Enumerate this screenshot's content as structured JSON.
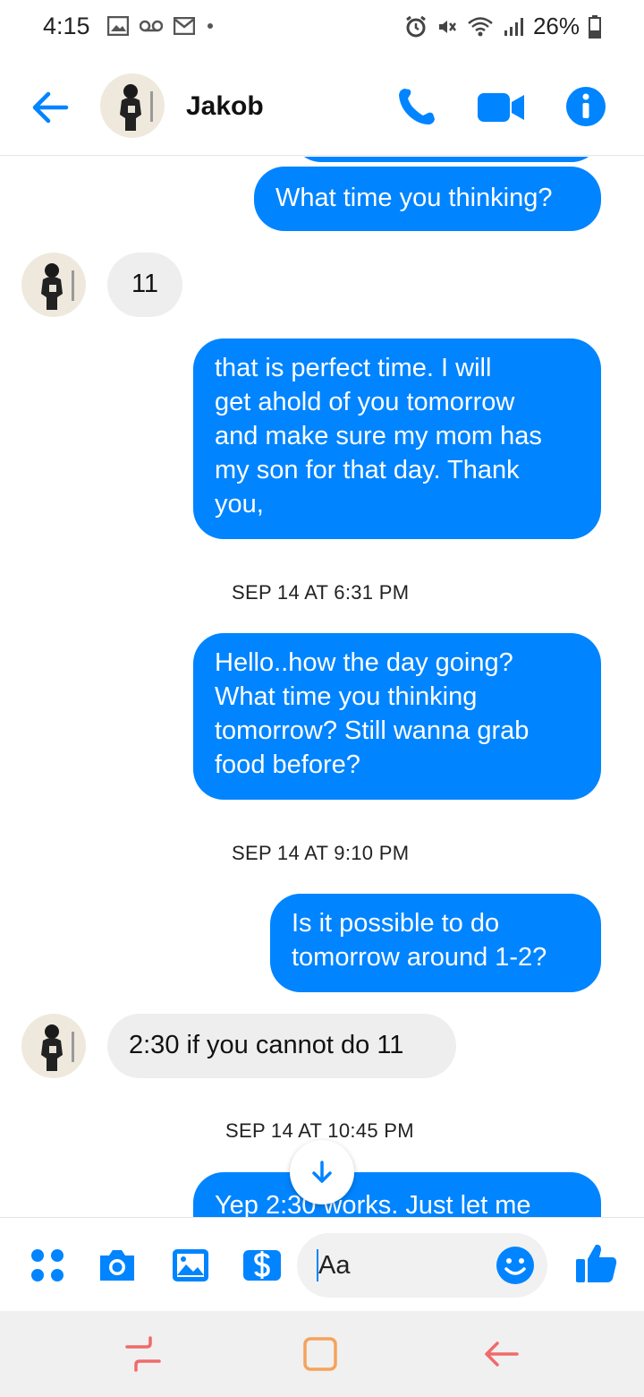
{
  "status_bar": {
    "time": "4:15",
    "battery": "26%"
  },
  "header": {
    "contact_name": "Jakob"
  },
  "messages": [
    {
      "dir": "out",
      "text": "What time you thinking?"
    },
    {
      "dir": "in",
      "text": "11"
    },
    {
      "dir": "out",
      "lines": [
        "that is perfect time.  I will",
        "get ahold of you tomorrow",
        "and make sure my mom has",
        "my son for that day. Thank",
        "you,"
      ]
    },
    {
      "dir": "stamp",
      "text": "SEP 14 AT 6:31 PM"
    },
    {
      "dir": "out",
      "lines": [
        "Hello..how the day going?",
        "What time  you thinking",
        "tomorrow? Still wanna grab",
        "food before?"
      ]
    },
    {
      "dir": "stamp",
      "text": "SEP 14 AT 9:10 PM"
    },
    {
      "dir": "out",
      "lines": [
        "Is it possible  to do",
        "tomorrow  around 1-2?"
      ]
    },
    {
      "dir": "in",
      "text": "2:30 if you cannot do 11"
    },
    {
      "dir": "stamp",
      "text": "SEP 14 AT 10:45 PM"
    },
    {
      "dir": "out",
      "text": "Yep  2:30 works. Just let me"
    }
  ],
  "composer": {
    "input_value": "Aa"
  },
  "colors": {
    "accent": "#0084ff",
    "incoming_bubble": "#eeeeee",
    "nav_icon": "#f06a6a"
  }
}
